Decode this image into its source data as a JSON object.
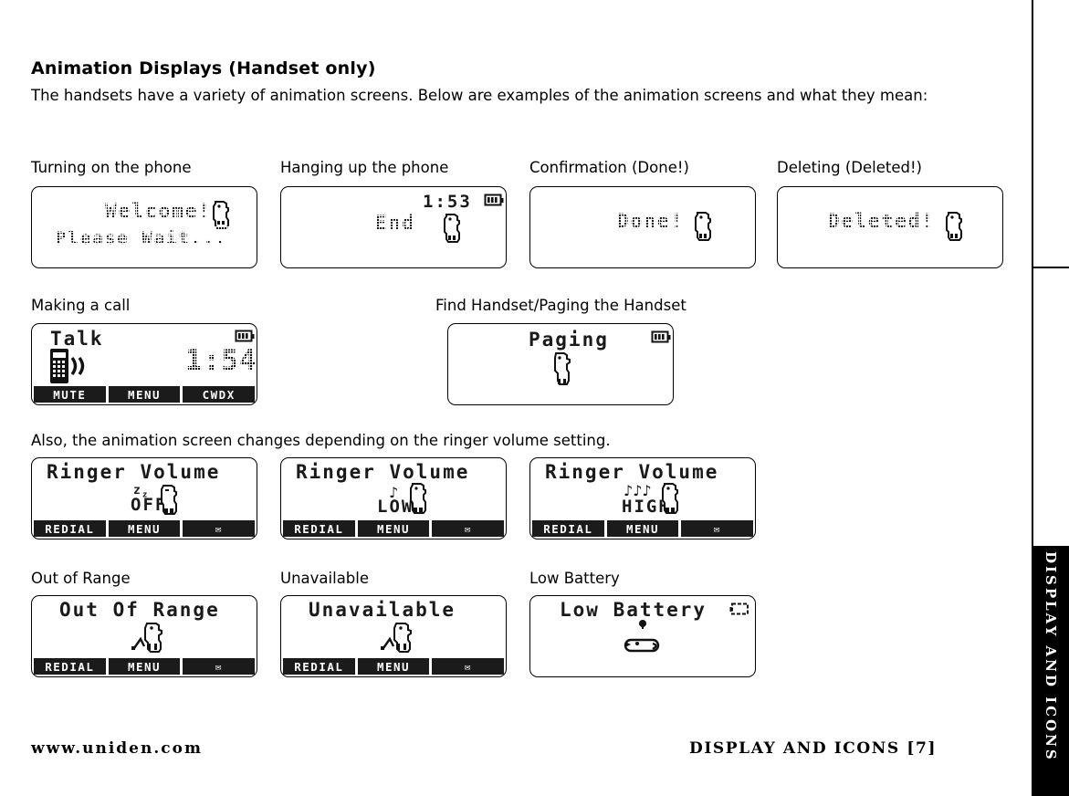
{
  "section": {
    "title": "Animation Displays (Handset only)",
    "intro": "The handsets have a variety of animation screens. Below are examples of the animation screens and what they mean:",
    "note": "Also, the animation screen changes depending on the ringer volume setting."
  },
  "captions": {
    "turning_on": "Turning on the phone",
    "hanging_up": "Hanging up the phone",
    "confirmation": "Confirmation (Done!)",
    "deleting": "Deleting (Deleted!)",
    "making_call": "Making a call",
    "find_handset": "Find Handset/Paging the Handset",
    "out_of_range": "Out of Range",
    "unavailable": "Unavailable",
    "low_battery": "Low Battery"
  },
  "screens": {
    "welcome": {
      "line1": "Welcome!",
      "line2": "Please Wait...",
      "icon": "dog-animation-icon"
    },
    "end": {
      "label": "End",
      "clock": "1:53",
      "battery": "battery-full-icon",
      "icon": "dog-animation-icon"
    },
    "done": {
      "label": "Done!",
      "icon": "dog-animation-icon"
    },
    "deleted": {
      "label": "Deleted!",
      "icon": "dog-animation-icon"
    },
    "talk": {
      "label": "Talk",
      "clock": "1:54",
      "battery": "battery-full-icon",
      "handset_icon": "handset-signal-icon",
      "softkeys": [
        "MUTE",
        "MENU",
        "CWDX"
      ]
    },
    "paging": {
      "label": "Paging",
      "battery": "battery-full-icon",
      "icon": "dog-animation-icon"
    },
    "ringer_off": {
      "title": "Ringer Volume",
      "level": "OFF",
      "decoration": "sleep-zzz-icon",
      "icon": "dog-sleeping-icon",
      "softkeys": [
        "REDIAL",
        "MENU",
        "✉"
      ]
    },
    "ringer_low": {
      "title": "Ringer Volume",
      "level": "LOW",
      "decoration": "one-music-note-icon",
      "icon": "dog-animation-icon",
      "softkeys": [
        "REDIAL",
        "MENU",
        "✉"
      ]
    },
    "ringer_high": {
      "title": "Ringer Volume",
      "level": "HIGH",
      "decoration": "three-music-notes-icon",
      "icon": "dog-animation-icon",
      "softkeys": [
        "REDIAL",
        "MENU",
        "✉"
      ]
    },
    "out_of_range": {
      "label": "Out Of Range",
      "icon": "dog-digging-icon",
      "softkeys": [
        "REDIAL",
        "MENU",
        "✉"
      ]
    },
    "unavailable": {
      "label": "Unavailable",
      "icon": "dog-digging-icon",
      "softkeys": [
        "REDIAL",
        "MENU",
        "✉"
      ]
    },
    "low_battery": {
      "label": "Low Battery",
      "battery": "battery-empty-icon",
      "icon": "dog-lying-down-icon"
    }
  },
  "footer": {
    "website": "www.uniden.com",
    "page_ref": "DISPLAY AND ICONS [7]",
    "edge_tab": "DISPLAY AND ICONS"
  },
  "colors": {
    "ink": "#000000",
    "paper": "#ffffff",
    "softkey_bg": "#1b1b1b",
    "softkey_text": "#ffffff"
  }
}
